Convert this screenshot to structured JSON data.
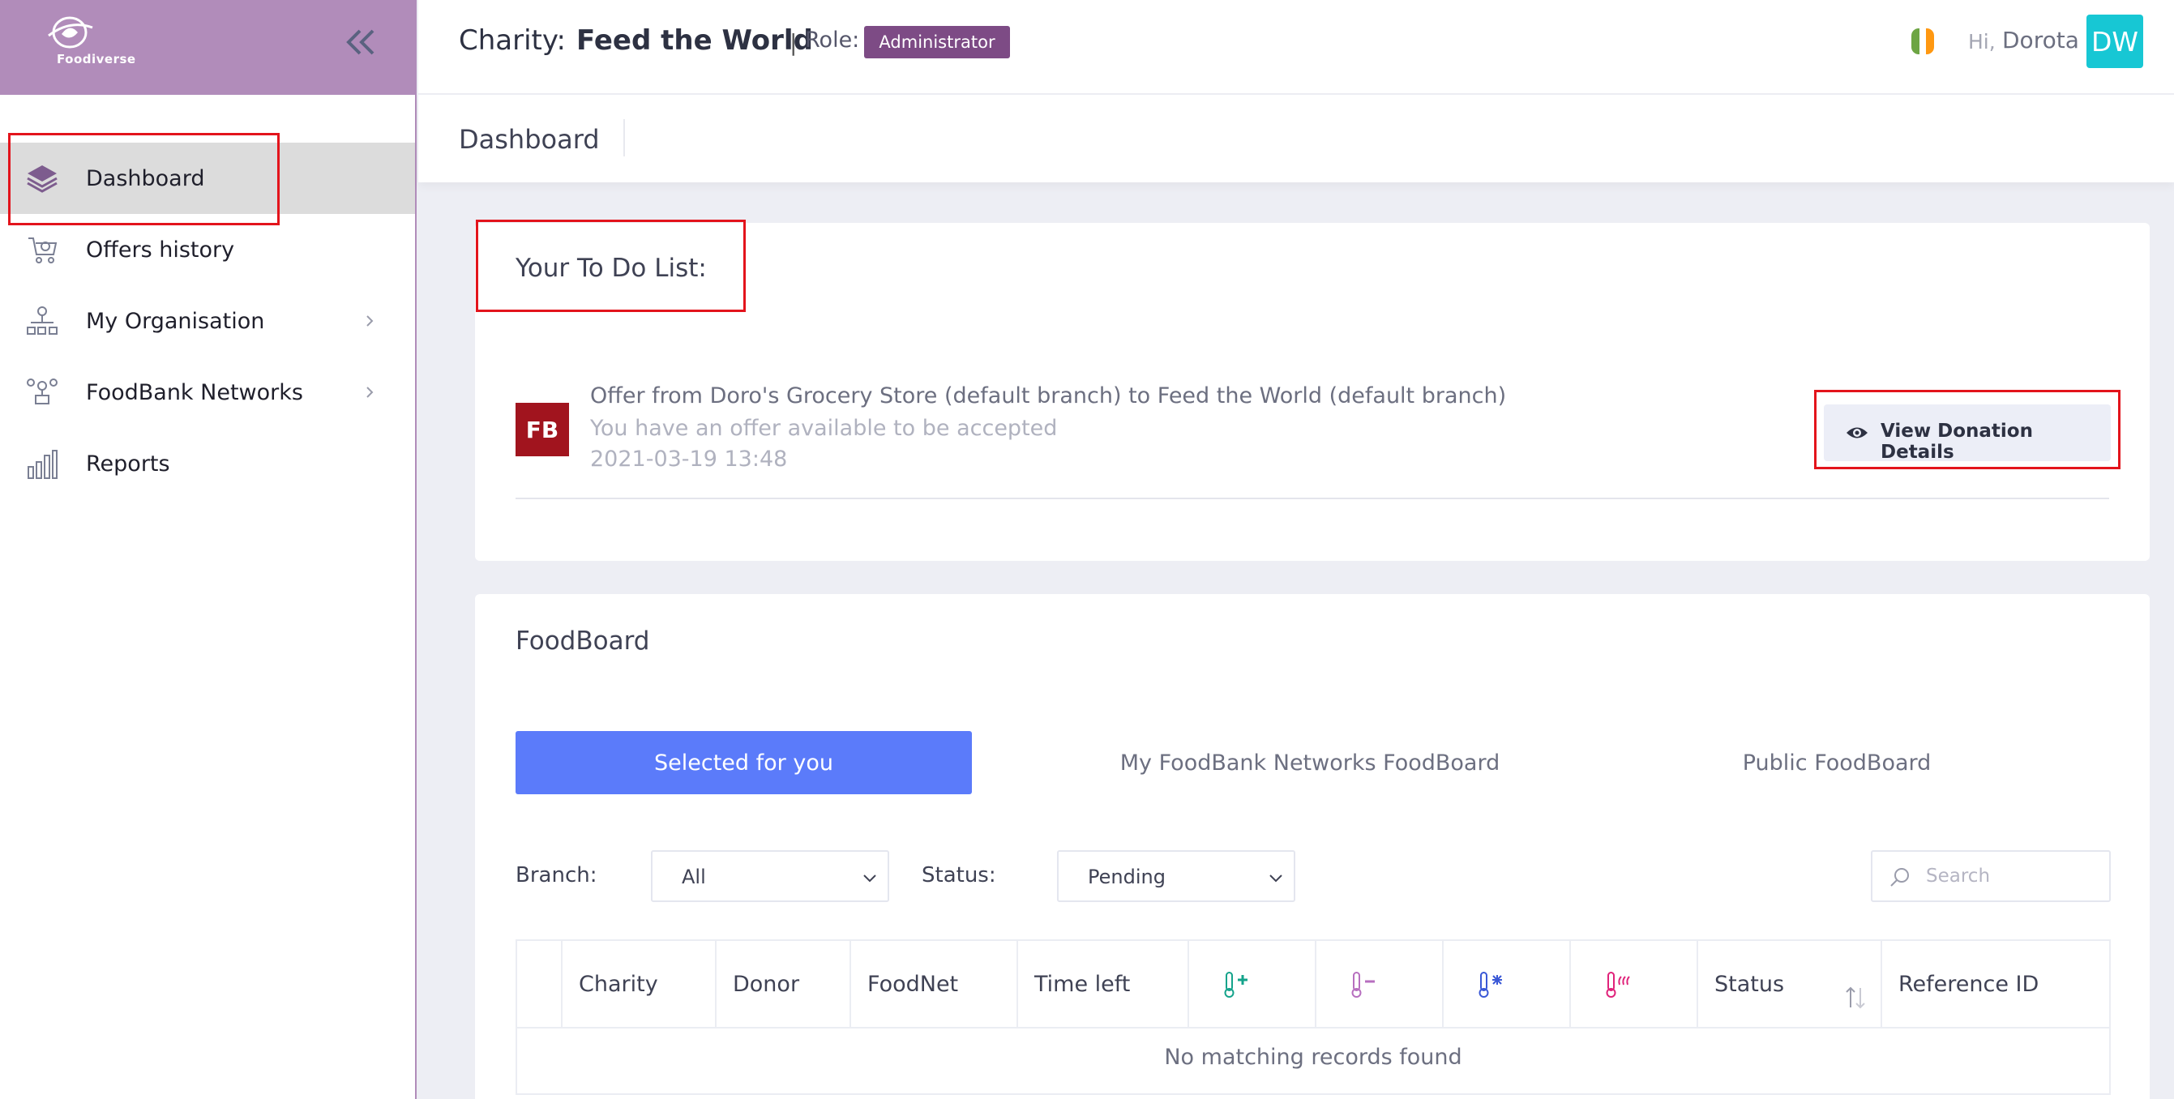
{
  "brand": {
    "name": "Foodiverse"
  },
  "sidebar": {
    "items": [
      {
        "label": "Dashboard",
        "icon": "layers-icon",
        "active": true
      },
      {
        "label": "Offers history",
        "icon": "offers-history-icon"
      },
      {
        "label": "My Organisation",
        "icon": "org-chart-icon",
        "has_submenu": true
      },
      {
        "label": "FoodBank Networks",
        "icon": "network-icon",
        "has_submenu": true
      },
      {
        "label": "Reports",
        "icon": "bar-chart-icon"
      }
    ]
  },
  "header": {
    "charity_label": "Charity:",
    "charity_name": "Feed the World",
    "separator": "|",
    "role_label": "Role:",
    "role": "Administrator",
    "greeting": "Hi,",
    "user_name": "Dorota",
    "avatar_initials": "DW"
  },
  "subheader": {
    "title": "Dashboard"
  },
  "todo": {
    "title": "Your To Do List:",
    "items": [
      {
        "badge": "FB",
        "title": "Offer from Doro's Grocery Store (default branch) to Feed the World (default branch)",
        "subtitle": "You have an offer available to be accepted",
        "date": "2021-03-19 13:48",
        "action_label": "View Donation Details"
      }
    ]
  },
  "foodboard": {
    "title": "FoodBoard",
    "tabs": [
      {
        "label": "Selected for you",
        "active": true
      },
      {
        "label": "My FoodBank Networks FoodBoard"
      },
      {
        "label": "Public FoodBoard"
      }
    ],
    "filters": {
      "branch_label": "Branch:",
      "branch_value": "All",
      "status_label": "Status:",
      "status_value": "Pending",
      "search_placeholder": "Search"
    },
    "table": {
      "columns": [
        "",
        "Charity",
        "Donor",
        "FoodNet",
        "Time left",
        "ambient-icon",
        "chilled-icon",
        "frozen-icon",
        "hot-icon",
        "Status",
        "Reference ID"
      ],
      "empty_message": "No matching records found"
    }
  },
  "colors": {
    "brand": "#b18cba",
    "role_badge": "#7d4b85",
    "avatar": "#17c7d4",
    "active_tab": "#5b7bfa",
    "fb_badge": "#a1141e",
    "highlight": "#e3141c"
  }
}
